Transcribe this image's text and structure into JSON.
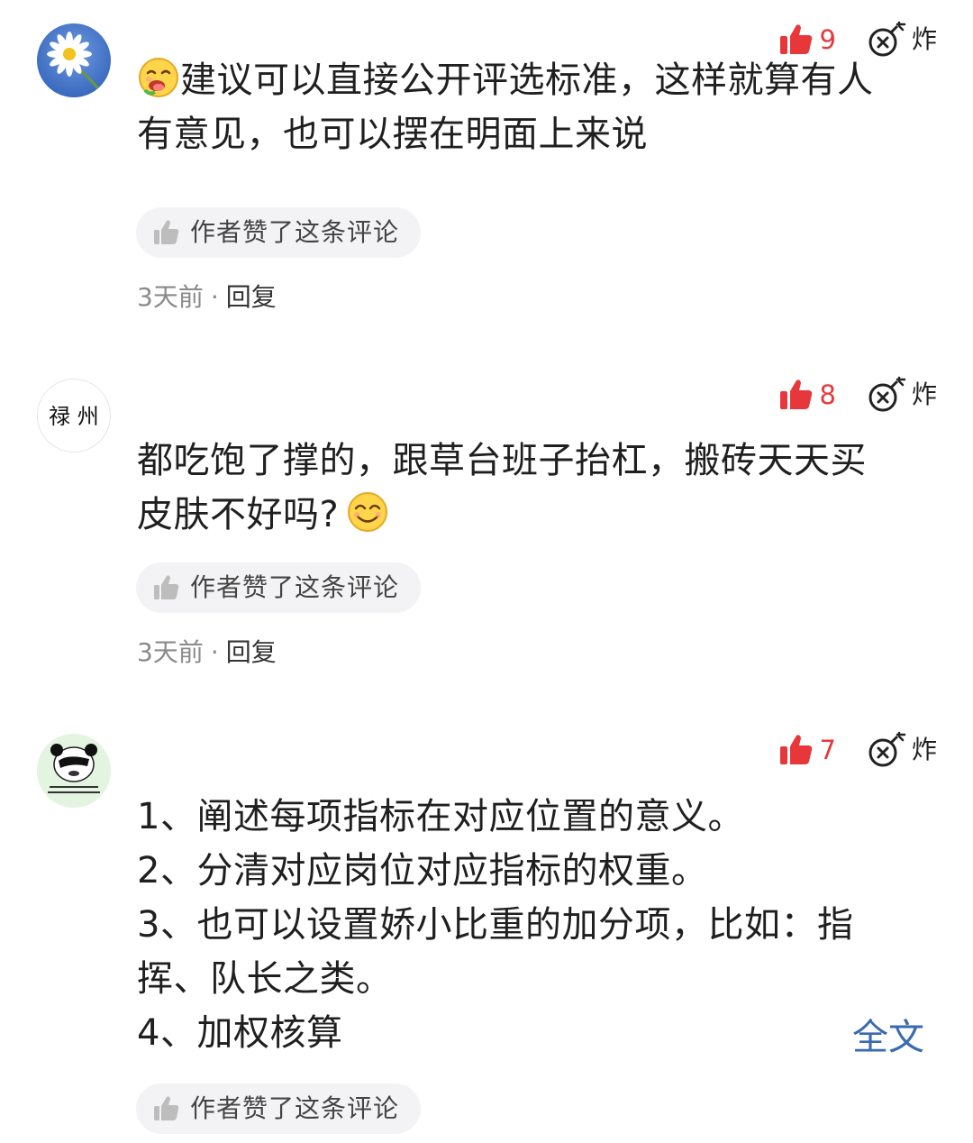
{
  "comments": [
    {
      "avatar_icon": "daisy-flower-avatar",
      "likes": "9",
      "bomb_label": "炸",
      "emoji": "drooling-face-emoji",
      "lines": [
        "建议可以直接公开评选标准，这样就算有人",
        "有意见，也可以摆在明面上来说"
      ],
      "author_liked": "作者赞了这条评论",
      "time": "3天前",
      "dot": "·",
      "reply": "回复"
    },
    {
      "avatar_icon": "calligraphy-avatar",
      "avatar_text": "禄 州",
      "likes": "8",
      "bomb_label": "炸",
      "emoji": "smiling-face-emoji",
      "lines": [
        "都吃饱了撑的，跟草台班子抬杠，搬砖天天买",
        "皮肤不好吗?"
      ],
      "author_liked": "作者赞了这条评论",
      "time": "3天前",
      "dot": "·",
      "reply": "回复"
    },
    {
      "avatar_icon": "panda-meme-avatar",
      "likes": "7",
      "bomb_label": "炸",
      "lines": [
        "1、阐述每项指标在对应位置的意义。",
        "2、分清对应岗位对应指标的权重。",
        "3、也可以设置娇小比重的加分项，比如：指",
        "挥、队长之类。",
        "4、加权核算"
      ],
      "full_text_link": "全文",
      "author_liked": "作者赞了这条评论"
    }
  ],
  "colors": {
    "like_red": "#e8373a",
    "link_blue": "#3a6ab0",
    "pill_bg": "#f3f3f5",
    "meta_gray": "#8a8a8a"
  }
}
